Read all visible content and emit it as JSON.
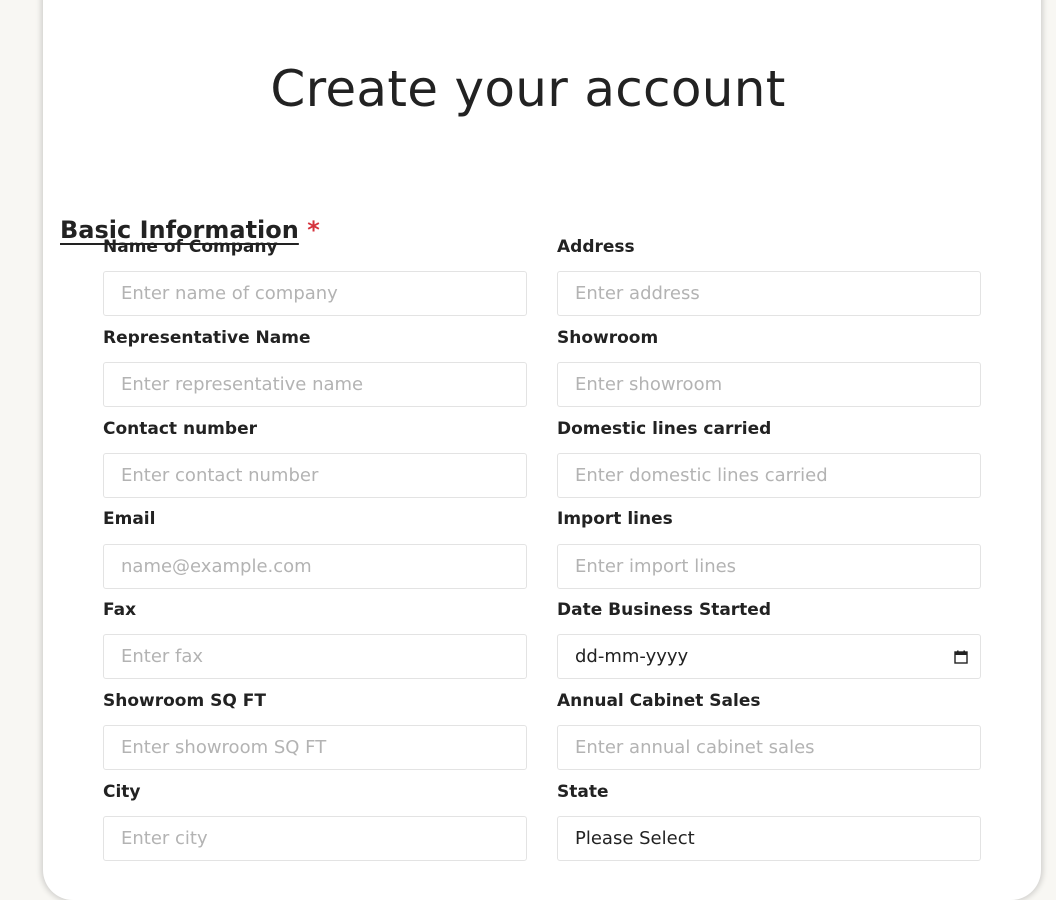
{
  "page": {
    "title": "Create your account"
  },
  "section": {
    "heading": "Basic Information",
    "required_marker": "*"
  },
  "fields": {
    "company": {
      "label": "Name of Company",
      "placeholder": "Enter name of company"
    },
    "address": {
      "label": "Address",
      "placeholder": "Enter address"
    },
    "representative": {
      "label": "Representative Name",
      "placeholder": "Enter representative name"
    },
    "showroom": {
      "label": "Showroom",
      "placeholder": "Enter showroom"
    },
    "contact": {
      "label": "Contact number",
      "placeholder": "Enter contact number"
    },
    "domestic": {
      "label": "Domestic lines carried",
      "placeholder": "Enter domestic lines carried"
    },
    "email": {
      "label": "Email",
      "placeholder": "name@example.com"
    },
    "import": {
      "label": "Import lines",
      "placeholder": "Enter import lines"
    },
    "fax": {
      "label": "Fax",
      "placeholder": "Enter fax"
    },
    "date_started": {
      "label": "Date Business Started",
      "value": "dd-mm-yyyy",
      "icon": "calendar-icon"
    },
    "sqft": {
      "label": "Showroom SQ FT",
      "placeholder": "Enter showroom SQ FT"
    },
    "annual_sales": {
      "label": "Annual Cabinet Sales",
      "placeholder": "Enter annual cabinet sales"
    },
    "city": {
      "label": "City",
      "placeholder": "Enter city"
    },
    "state": {
      "label": "State",
      "value": "Please Select"
    }
  },
  "colors": {
    "page_background": "#f8f7f3",
    "card_background": "#ffffff",
    "text": "#222222",
    "placeholder": "#b3b3b3",
    "required": "#d5333d",
    "input_border": "#e3e3e3"
  }
}
